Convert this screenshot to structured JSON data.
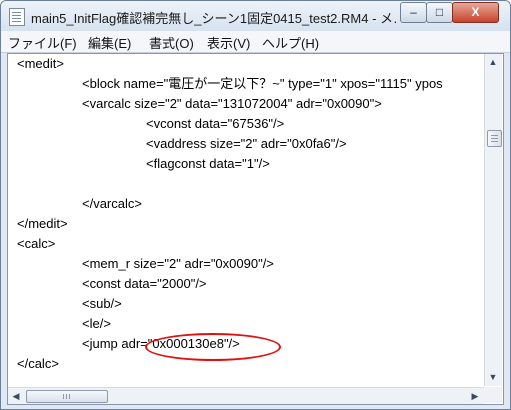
{
  "window": {
    "title": "main5_InitFlag確認補完無し_シーン1固定0415_test2.RM4 - メ…",
    "minimize_glyph": "–",
    "maximize_glyph": "□",
    "close_glyph": "X"
  },
  "menu": {
    "items": [
      {
        "label": "ファイル(F)"
      },
      {
        "label": "編集(E)"
      },
      {
        "label": "書式(O)"
      },
      {
        "label": "表示(V)"
      },
      {
        "label": "ヘルプ(H)"
      }
    ]
  },
  "editor": {
    "lines": [
      "<medit>",
      "<block name=\"電圧が一定以下？~\" type=\"1\" xpos=\"1115\" ypos",
      "<varcalc size=\"2\" data=\"131072004\" adr=\"0x0090\">",
      "<vconst data=\"67536\"/>",
      "<vaddress size=\"2\" adr=\"0x0fa6\"/>",
      "<flagconst data=\"1\"/>",
      "",
      "</varcalc>",
      "</medit>",
      "<calc>",
      "<mem_r size=\"2\" adr=\"0x0090\"/>",
      "<const data=\"2000\"/>",
      "<sub/>",
      "<le/>",
      "<jump adr=\"0x000130e8\"/>",
      "</calc>"
    ]
  },
  "scrollbars": {
    "up_glyph": "▲",
    "down_glyph": "▼",
    "left_glyph": "◀",
    "right_glyph": "▶"
  },
  "colors": {
    "highlight": "#e01010"
  }
}
